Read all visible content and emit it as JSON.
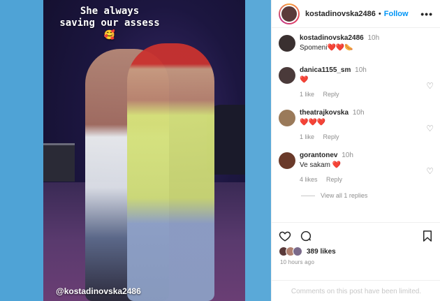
{
  "media": {
    "caption_line1": "She always",
    "caption_line2": "saving our assess",
    "caption_emoji": "🥰",
    "watermark": "@kostadinovska2486"
  },
  "header": {
    "username": "kostadinovska2486",
    "separator": "•",
    "follow_label": "Follow",
    "more_label": "•••"
  },
  "comments": [
    {
      "username": "kostadinovska2486",
      "time": "10h",
      "text": "Spomeni",
      "emojis": "❤️❤️🌭",
      "avatar_color": "#3a3030"
    },
    {
      "username": "danica1155_sm",
      "time": "10h",
      "text": "",
      "emojis": "❤️",
      "likes": "1 like",
      "reply": "Reply",
      "avatar_color": "#4a3a3a"
    },
    {
      "username": "theatrajkovska",
      "time": "10h",
      "text": "",
      "emojis": "❤️❤️❤️",
      "likes": "1 like",
      "reply": "Reply",
      "avatar_color": "#9a7a5a"
    },
    {
      "username": "gorantonev",
      "time": "10h",
      "text": "Ve sakam",
      "emojis": "❤️",
      "likes": "4 likes",
      "reply": "Reply",
      "avatar_color": "#6a3a2a"
    }
  ],
  "view_replies": "View all 1 replies",
  "actions": {
    "likes_count": "389 likes",
    "time_ago": "10 hours ago",
    "comments_limited": "Comments on this post have been limited."
  },
  "colors": {
    "accent": "#0095f6",
    "heart": "#ed1c24",
    "muted": "#8e8e8e"
  }
}
